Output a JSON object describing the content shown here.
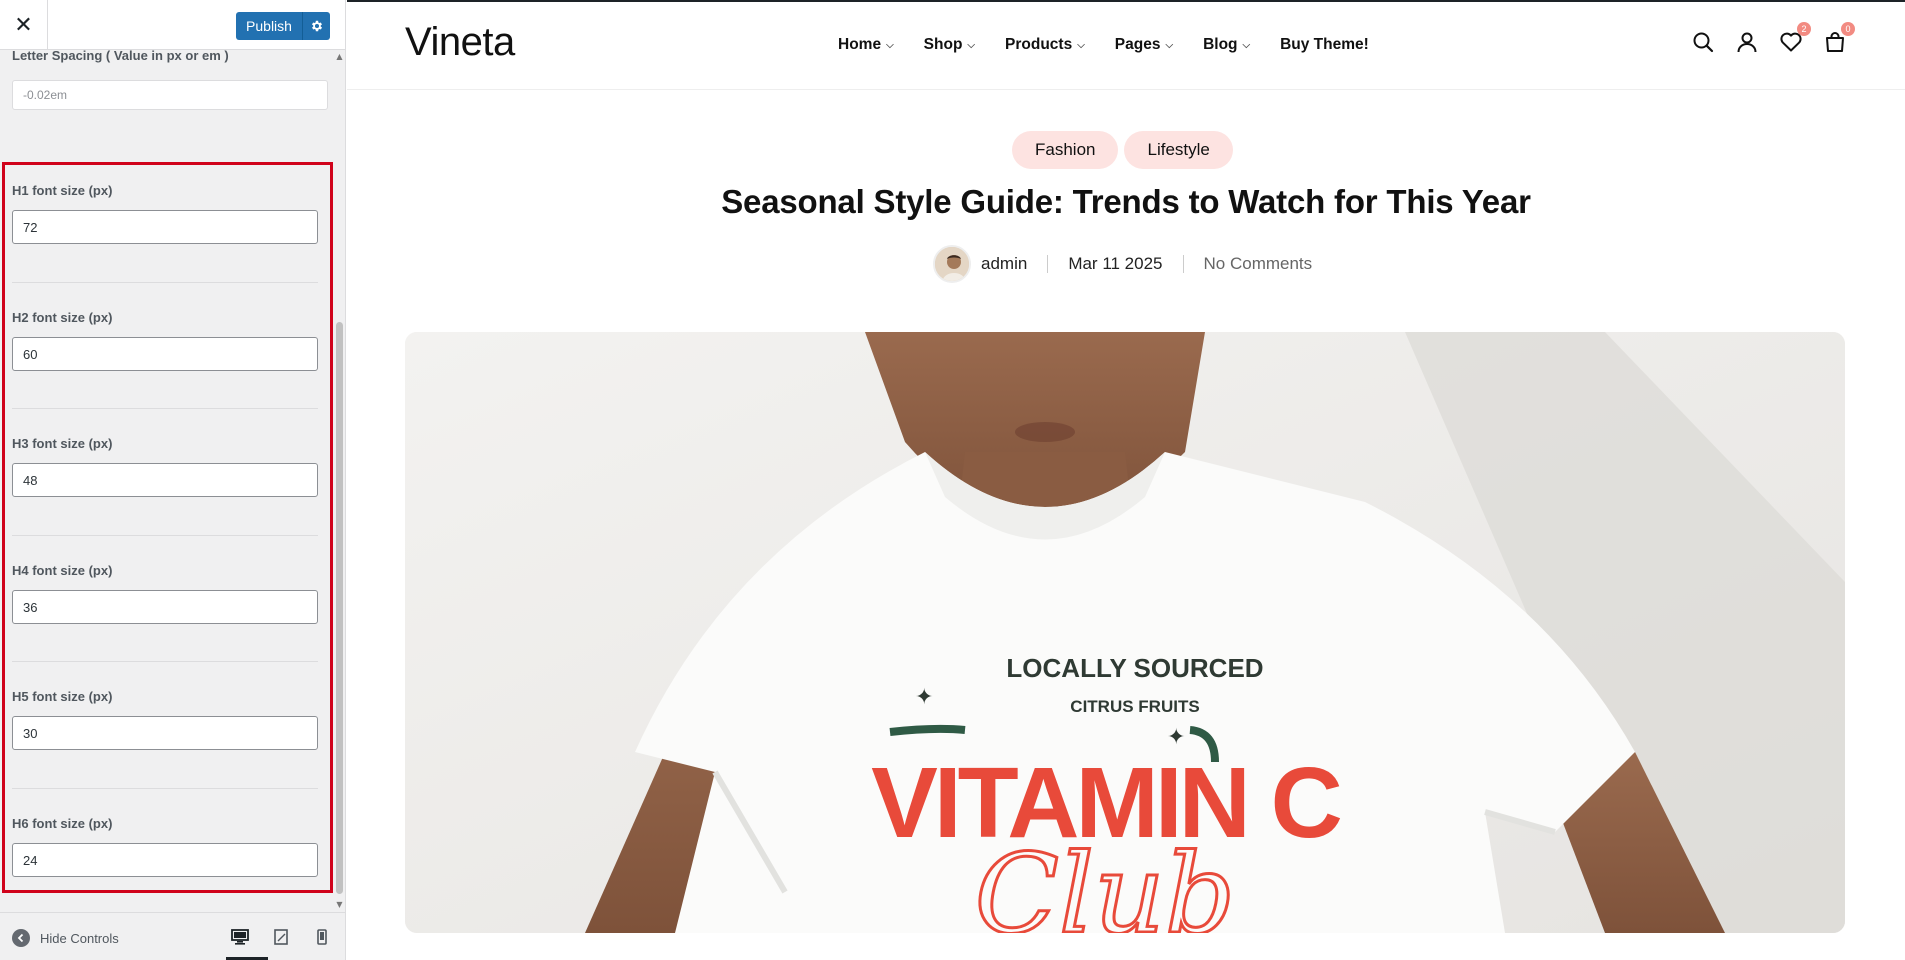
{
  "customizer": {
    "publish_label": "Publish",
    "top_field": {
      "label": "Letter Spacing ( Value in px or em )",
      "value": "-0.02em"
    },
    "heading_fields": [
      {
        "label": "H1 font size (px)",
        "value": "72"
      },
      {
        "label": "H2 font size (px)",
        "value": "60"
      },
      {
        "label": "H3 font size (px)",
        "value": "48"
      },
      {
        "label": "H4 font size (px)",
        "value": "36"
      },
      {
        "label": "H5 font size (px)",
        "value": "30"
      },
      {
        "label": "H6 font size (px)",
        "value": "24"
      }
    ],
    "hide_controls_label": "Hide Controls",
    "highlight_color": "#d0021b",
    "accent_color": "#2271b1"
  },
  "site": {
    "logo": "Vineta",
    "nav": [
      {
        "label": "Home",
        "has_dropdown": true
      },
      {
        "label": "Shop",
        "has_dropdown": true
      },
      {
        "label": "Products",
        "has_dropdown": true
      },
      {
        "label": "Pages",
        "has_dropdown": true
      },
      {
        "label": "Blog",
        "has_dropdown": true
      },
      {
        "label": "Buy Theme!",
        "has_dropdown": false
      }
    ],
    "wishlist_count": "2",
    "cart_count": "0",
    "icons": [
      "search-icon",
      "user-icon",
      "heart-icon",
      "bag-icon"
    ]
  },
  "post": {
    "tags": [
      "Fashion",
      "Lifestyle"
    ],
    "title": "Seasonal Style Guide: Trends to Watch for This Year",
    "author": "admin",
    "date": "Mar 11 2025",
    "comments": "No Comments",
    "shirt_print": {
      "line1": "LOCALLY SOURCED",
      "line2": "CITRUS FRUITS",
      "line3": "VITAMIN C",
      "line4": "Club"
    },
    "tag_color": "#fde3e1"
  }
}
